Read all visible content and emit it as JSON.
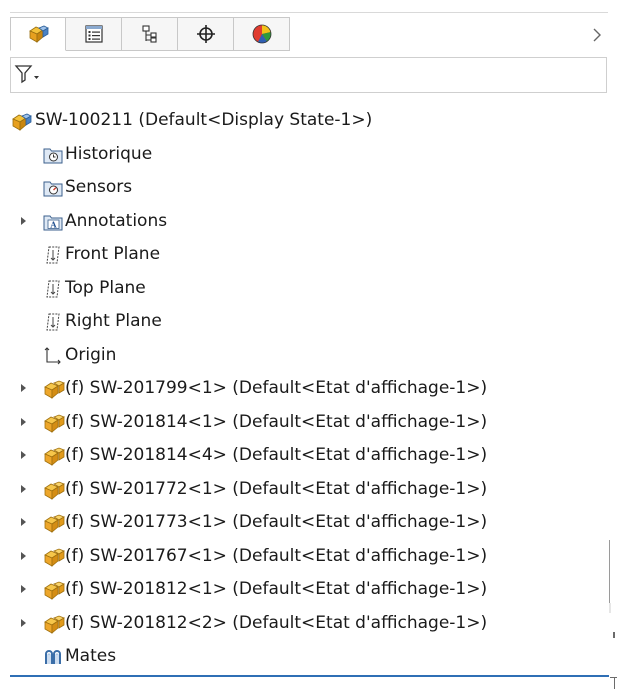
{
  "tabs": [
    {
      "name": "feature-manager-tab",
      "icon": "assembly-icon",
      "active": true
    },
    {
      "name": "property-manager-tab",
      "icon": "property-list-icon"
    },
    {
      "name": "configuration-manager-tab",
      "icon": "configuration-icon"
    },
    {
      "name": "dimxpert-manager-tab",
      "icon": "crosshair-icon"
    },
    {
      "name": "display-manager-tab",
      "icon": "appearance-sphere-icon"
    }
  ],
  "filter": {
    "icon": "filter-funnel-icon"
  },
  "tree": {
    "root": {
      "label": "SW-100211  (Default<Display State-1>)",
      "icon": "assembly-icon"
    },
    "items": [
      {
        "label": "Historique",
        "icon": "history-folder-icon",
        "expandable": false
      },
      {
        "label": "Sensors",
        "icon": "sensors-folder-icon",
        "expandable": false
      },
      {
        "label": "Annotations",
        "icon": "annotations-folder-icon",
        "expandable": true
      },
      {
        "label": "Front Plane",
        "icon": "plane-icon",
        "expandable": false
      },
      {
        "label": "Top Plane",
        "icon": "plane-icon",
        "expandable": false
      },
      {
        "label": "Right Plane",
        "icon": "plane-icon",
        "expandable": false
      },
      {
        "label": "Origin",
        "icon": "origin-icon",
        "expandable": false
      },
      {
        "label": "(f) SW-201799<1> (Default<Etat d'affichage-1>)",
        "icon": "fixed-subassembly-icon",
        "expandable": true
      },
      {
        "label": "(f) SW-201814<1> (Default<Etat d'affichage-1>)",
        "icon": "fixed-subassembly-icon",
        "expandable": true
      },
      {
        "label": "(f) SW-201814<4> (Default<Etat d'affichage-1>)",
        "icon": "fixed-subassembly-icon",
        "expandable": true
      },
      {
        "label": "(f) SW-201772<1> (Default<Etat d'affichage-1>)",
        "icon": "fixed-subassembly-icon",
        "expandable": true
      },
      {
        "label": "(f) SW-201773<1> (Default<Etat d'affichage-1>)",
        "icon": "fixed-subassembly-icon",
        "expandable": true
      },
      {
        "label": "(f) SW-201767<1> (Default<Etat d'affichage-1>)",
        "icon": "fixed-subassembly-icon",
        "expandable": true
      },
      {
        "label": "(f) SW-201812<1> (Default<Etat d'affichage-1>)",
        "icon": "fixed-subassembly-icon",
        "expandable": true
      },
      {
        "label": "(f) SW-201812<2> (Default<Etat d'affichage-1>)",
        "icon": "fixed-subassembly-icon",
        "expandable": true
      },
      {
        "label": "Mates",
        "icon": "mates-icon",
        "expandable": false
      }
    ]
  },
  "colors": {
    "accent_line": "#2f6fb5",
    "subassembly_yellow": "#f2b233",
    "assembly_blue": "#4b82c3"
  }
}
